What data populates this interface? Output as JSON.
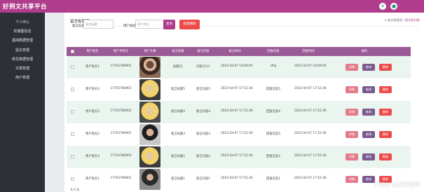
{
  "app": {
    "title": "好例文共享平台"
  },
  "colors": {
    "brand": "#b03d8c",
    "sidebar": "#2d3137",
    "table_head": "#9a5a96",
    "btn_query": "#e37a8c",
    "btn_edit": "#7a5a8f",
    "btn_delete": "#ef4a4a"
  },
  "sidebar": {
    "items": [
      {
        "label": "个人中心"
      },
      {
        "label": "轮播图信息"
      },
      {
        "label": "基础数据管理"
      },
      {
        "label": "留言管理"
      },
      {
        "label": "常见数据管理"
      },
      {
        "label": "文章管理"
      },
      {
        "label": "用户管理"
      }
    ]
  },
  "page": {
    "title": "留言板管理",
    "breadcrumb": {
      "home": "⌂",
      "level1": "留言板管理",
      "sep": "/",
      "level2": "留言板列表"
    }
  },
  "filter": {
    "field1_label": "留言标题",
    "field1_placeholder": "留言标题",
    "field2_label": "用户姓名",
    "field2_placeholder": "用户姓名",
    "search_label": "查询",
    "batch_delete_label": "批量删除"
  },
  "table": {
    "columns": [
      "用户姓名",
      "用户手机号",
      "用户头像",
      "留言标题",
      "留言内容",
      "留言时间",
      "回复内容",
      "回复时间",
      "操作"
    ],
    "rows": [
      {
        "name": "用户姓名1",
        "phone": "17703786901",
        "title": "标题11",
        "content": "内容1111",
        "time": "2022-04-07 19:09:05",
        "reply": "sfhjj",
        "reply_time": "2022-04-07 19:09:05",
        "avatar": "avatar-1"
      },
      {
        "name": "用户姓名3",
        "phone": "17703786903",
        "title": "留言标题5",
        "content": "留言内容5",
        "time": "2022-04-07 17:52:36",
        "reply": "回复信息5",
        "reply_time": "2022-04-07 17:52:36",
        "avatar": "avatar-2"
      },
      {
        "name": "用户姓名3",
        "phone": "17703786903",
        "title": "留言标题4",
        "content": "留言内容4",
        "time": "2022-04-07 17:52:36",
        "reply": "回复信息4",
        "reply_time": "2022-04-07 17:52:36",
        "avatar": "avatar-3"
      },
      {
        "name": "用户姓名2",
        "phone": "17703786902",
        "title": "留言标题3",
        "content": "留言内容3",
        "time": "2022-04-07 17:52:36",
        "reply": "回复信息3",
        "reply_time": "2022-04-07 17:52:36",
        "avatar": "avatar-4"
      },
      {
        "name": "用户姓名3",
        "phone": "17703786903",
        "title": "留言标题2",
        "content": "留言内容2",
        "time": "2022-04-07 17:52:36",
        "reply": "回复信息2",
        "reply_time": "2022-04-07 17:52:36",
        "avatar": "avatar-5"
      },
      {
        "name": "用户姓名1",
        "phone": "17703786901",
        "title": "留言标题1",
        "content": "留言内容1",
        "time": "2022-04-07 17:52:36",
        "reply": "回复信息1",
        "reply_time": "2022-04-07 17:52:36",
        "avatar": "avatar-6"
      }
    ],
    "actions": {
      "view": "详情",
      "edit": "修改",
      "delete": "删除"
    }
  },
  "footer": {
    "text": "共 6 条"
  },
  "watermark": "CSDN @瀚文编程",
  "icons": {
    "top_icon_1": "collapse-icon",
    "top_icon_2": "user-icon"
  }
}
